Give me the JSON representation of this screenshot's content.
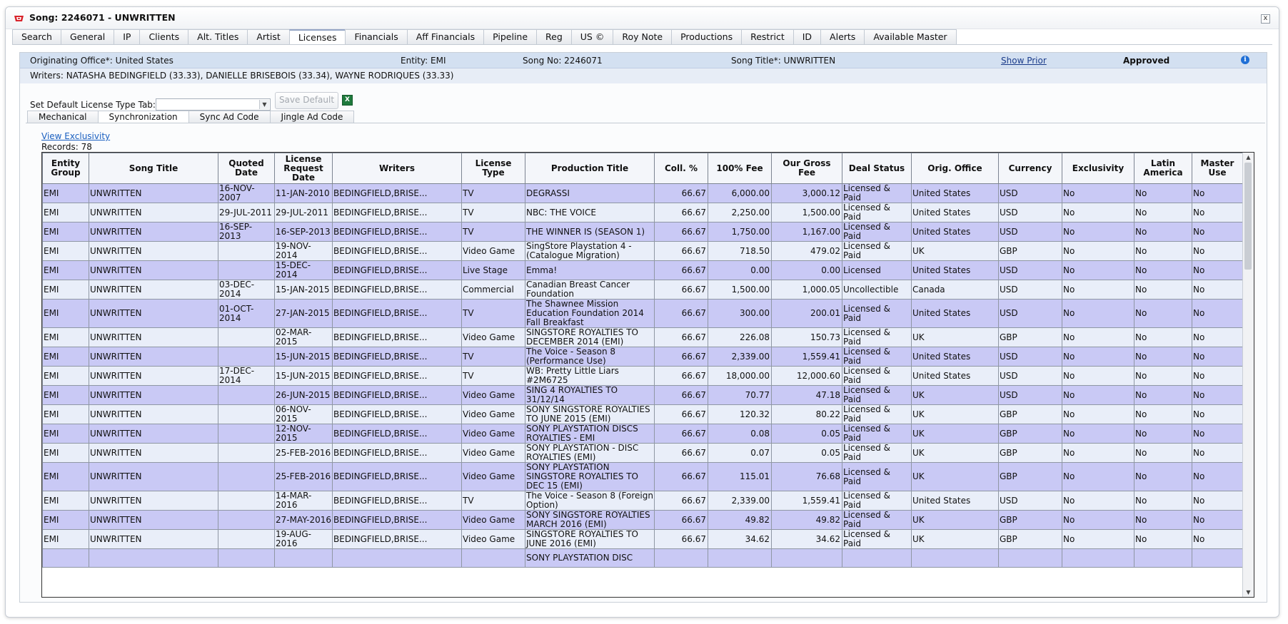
{
  "window": {
    "title": "Song: 2246071 - UNWRITTEN",
    "close_glyph": "x"
  },
  "tabs": [
    {
      "label": "Search"
    },
    {
      "label": "General"
    },
    {
      "label": "IP"
    },
    {
      "label": "Clients"
    },
    {
      "label": "Alt. Titles"
    },
    {
      "label": "Artist"
    },
    {
      "label": "Licenses",
      "active": true
    },
    {
      "label": "Financials"
    },
    {
      "label": "Aff Financials"
    },
    {
      "label": "Pipeline"
    },
    {
      "label": "Reg"
    },
    {
      "label": "US ©"
    },
    {
      "label": "Roy Note"
    },
    {
      "label": "Productions"
    },
    {
      "label": "Restrict"
    },
    {
      "label": "ID"
    },
    {
      "label": "Alerts"
    },
    {
      "label": "Available Master"
    }
  ],
  "header": {
    "originating_office": "Originating Office*: United States",
    "entity": "Entity: EMI",
    "song_no": "Song No: 2246071",
    "song_title": "Song Title*: UNWRITTEN",
    "show_prior": "Show Prior",
    "status": "Approved",
    "writers": "Writers: NATASHA BEDINGFIELD (33.33), DANIELLE BRISEBOIS (33.34), WAYNE RODRIQUES (33.33)"
  },
  "toolbar": {
    "default_tab_label": "Set Default License Type Tab:",
    "default_tab_value": "",
    "save_default": "Save Default"
  },
  "subtabs": [
    {
      "label": "Mechanical"
    },
    {
      "label": "Synchronization",
      "active": true
    },
    {
      "label": "Sync Ad Code"
    },
    {
      "label": "Jingle Ad Code"
    }
  ],
  "view_exclusivity": "View Exclusivity",
  "records": "Records: 78",
  "columns": [
    "Entity Group",
    "Song Title",
    "Quoted Date",
    "License Request Date",
    "Writers",
    "License Type",
    "Production Title",
    "Coll. %",
    "100% Fee",
    "Our Gross Fee",
    "Deal Status",
    "Orig. Office",
    "Currency",
    "Exclusivity",
    "Latin America",
    "Master Use"
  ],
  "rows": [
    [
      "EMI",
      "UNWRITTEN",
      "16-NOV-2007",
      "11-JAN-2010",
      "BEDINGFIELD,BRISE...",
      "TV",
      "DEGRASSI",
      "66.67",
      "6,000.00",
      "3,000.12",
      "Licensed & Paid",
      "United States",
      "USD",
      "No",
      "No",
      "No"
    ],
    [
      "EMI",
      "UNWRITTEN",
      "29-JUL-2011",
      "29-JUL-2011",
      "BEDINGFIELD,BRISE...",
      "TV",
      "NBC: THE VOICE",
      "66.67",
      "2,250.00",
      "1,500.00",
      "Licensed & Paid",
      "United States",
      "USD",
      "No",
      "No",
      "No"
    ],
    [
      "EMI",
      "UNWRITTEN",
      "16-SEP-2013",
      "16-SEP-2013",
      "BEDINGFIELD,BRISE...",
      "TV",
      "THE WINNER IS (SEASON 1)",
      "66.67",
      "1,750.00",
      "1,167.00",
      "Licensed & Paid",
      "United States",
      "USD",
      "No",
      "No",
      "No"
    ],
    [
      "EMI",
      "UNWRITTEN",
      "",
      "19-NOV-2014",
      "BEDINGFIELD,BRISE...",
      "Video Game",
      "SingStore Playstation 4 - (Catalogue Migration)",
      "66.67",
      "718.50",
      "479.02",
      "Licensed & Paid",
      "UK",
      "GBP",
      "No",
      "No",
      "No"
    ],
    [
      "EMI",
      "UNWRITTEN",
      "",
      "15-DEC-2014",
      "BEDINGFIELD,BRISE...",
      "Live Stage",
      "Emma!",
      "66.67",
      "0.00",
      "0.00",
      "Licensed",
      "United States",
      "USD",
      "No",
      "No",
      "No"
    ],
    [
      "EMI",
      "UNWRITTEN",
      "03-DEC-2014",
      "15-JAN-2015",
      "BEDINGFIELD,BRISE...",
      "Commercial",
      "Canadian Breast Cancer Foundation",
      "66.67",
      "1,500.00",
      "1,000.05",
      "Uncollectible",
      "Canada",
      "USD",
      "No",
      "No",
      "No"
    ],
    [
      "EMI",
      "UNWRITTEN",
      "01-OCT-2014",
      "27-JAN-2015",
      "BEDINGFIELD,BRISE...",
      "TV",
      "The Shawnee Mission Education Foundation 2014 Fall Breakfast",
      "66.67",
      "300.00",
      "200.01",
      "Licensed & Paid",
      "United States",
      "USD",
      "No",
      "No",
      "No"
    ],
    [
      "EMI",
      "UNWRITTEN",
      "",
      "02-MAR-2015",
      "BEDINGFIELD,BRISE...",
      "Video Game",
      "SINGSTORE ROYALTIES TO DECEMBER 2014 (EMI)",
      "66.67",
      "226.08",
      "150.73",
      "Licensed & Paid",
      "UK",
      "GBP",
      "No",
      "No",
      "No"
    ],
    [
      "EMI",
      "UNWRITTEN",
      "",
      "15-JUN-2015",
      "BEDINGFIELD,BRISE...",
      "TV",
      "The Voice - Season 8 (Performance Use)",
      "66.67",
      "2,339.00",
      "1,559.41",
      "Licensed & Paid",
      "United States",
      "USD",
      "No",
      "No",
      "No"
    ],
    [
      "EMI",
      "UNWRITTEN",
      "17-DEC-2014",
      "15-JUN-2015",
      "BEDINGFIELD,BRISE...",
      "TV",
      "WB: Pretty Little Liars #2M6725",
      "66.67",
      "18,000.00",
      "12,000.60",
      "Licensed & Paid",
      "United States",
      "USD",
      "No",
      "No",
      "No"
    ],
    [
      "EMI",
      "UNWRITTEN",
      "",
      "26-JUN-2015",
      "BEDINGFIELD,BRISE...",
      "Video Game",
      "SING 4 ROYALTIES TO 31/12/14",
      "66.67",
      "70.77",
      "47.18",
      "Licensed & Paid",
      "UK",
      "USD",
      "No",
      "No",
      "No"
    ],
    [
      "EMI",
      "UNWRITTEN",
      "",
      "06-NOV-2015",
      "BEDINGFIELD,BRISE...",
      "Video Game",
      "SONY SINGSTORE ROYALTIES TO JUNE 2015 (EMI)",
      "66.67",
      "120.32",
      "80.22",
      "Licensed & Paid",
      "UK",
      "GBP",
      "No",
      "No",
      "No"
    ],
    [
      "EMI",
      "UNWRITTEN",
      "",
      "12-NOV-2015",
      "BEDINGFIELD,BRISE...",
      "Video Game",
      "SONY PLAYSTATION DISCS ROYALTIES - EMI",
      "66.67",
      "0.08",
      "0.05",
      "Licensed & Paid",
      "UK",
      "GBP",
      "No",
      "No",
      "No"
    ],
    [
      "EMI",
      "UNWRITTEN",
      "",
      "25-FEB-2016",
      "BEDINGFIELD,BRISE...",
      "Video Game",
      "SONY PLAYSTATION - DISC ROYALTIES (EMI)",
      "66.67",
      "0.07",
      "0.05",
      "Licensed & Paid",
      "UK",
      "GBP",
      "No",
      "No",
      "No"
    ],
    [
      "EMI",
      "UNWRITTEN",
      "",
      "25-FEB-2016",
      "BEDINGFIELD,BRISE...",
      "Video Game",
      "SONY PLAYSTATION SINGSTORE ROYALTIES TO DEC 15 (EMI)",
      "66.67",
      "115.01",
      "76.68",
      "Licensed & Paid",
      "UK",
      "GBP",
      "No",
      "No",
      "No"
    ],
    [
      "EMI",
      "UNWRITTEN",
      "",
      "14-MAR-2016",
      "BEDINGFIELD,BRISE...",
      "TV",
      "The Voice - Season 8 (Foreign Option)",
      "66.67",
      "2,339.00",
      "1,559.41",
      "Licensed & Paid",
      "United States",
      "USD",
      "No",
      "No",
      "No"
    ],
    [
      "EMI",
      "UNWRITTEN",
      "",
      "27-MAY-2016",
      "BEDINGFIELD,BRISE...",
      "Video Game",
      "SONY SINGSTORE ROYALTIES MARCH 2016 (EMI)",
      "66.67",
      "49.82",
      "49.82",
      "Licensed & Paid",
      "UK",
      "GBP",
      "No",
      "No",
      "No"
    ],
    [
      "EMI",
      "UNWRITTEN",
      "",
      "19-AUG-2016",
      "BEDINGFIELD,BRISE...",
      "Video Game",
      "SINGSTORE ROYALTIES TO JUNE 2016 (EMI)",
      "66.67",
      "34.62",
      "34.62",
      "Licensed & Paid",
      "UK",
      "GBP",
      "No",
      "No",
      "No"
    ],
    [
      "",
      "",
      "",
      "",
      "",
      "",
      "SONY PLAYSTATION DISC",
      "",
      "",
      "",
      "",
      "",
      "",
      "",
      "",
      ""
    ]
  ],
  "colors": {
    "row_odd": "#c9c9f5",
    "row_even": "#e9eef9",
    "header_band": "#d3e0f1",
    "link": "#1a5fc0"
  }
}
